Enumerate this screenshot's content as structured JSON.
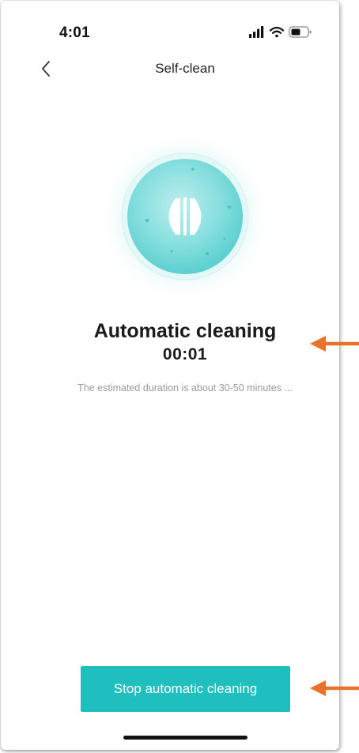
{
  "status_bar": {
    "time": "4:01",
    "icons": [
      "signal-icon",
      "wifi-icon",
      "battery-icon"
    ]
  },
  "nav": {
    "back_icon": "chevron-left-icon",
    "title": "Self-clean"
  },
  "illustration": {
    "icon": "cleaning-ball-icon"
  },
  "status": {
    "title": "Automatic cleaning",
    "timer": "00:01",
    "estimate": "The estimated duration is about 30-50 minutes ..."
  },
  "actions": {
    "stop_label": "Stop automatic cleaning"
  },
  "annotations": {
    "arrow_color": "#e8712c"
  },
  "colors": {
    "accent": "#20bfbf",
    "title_text": "#1a1a1a",
    "muted_text": "#9a9a9a"
  }
}
